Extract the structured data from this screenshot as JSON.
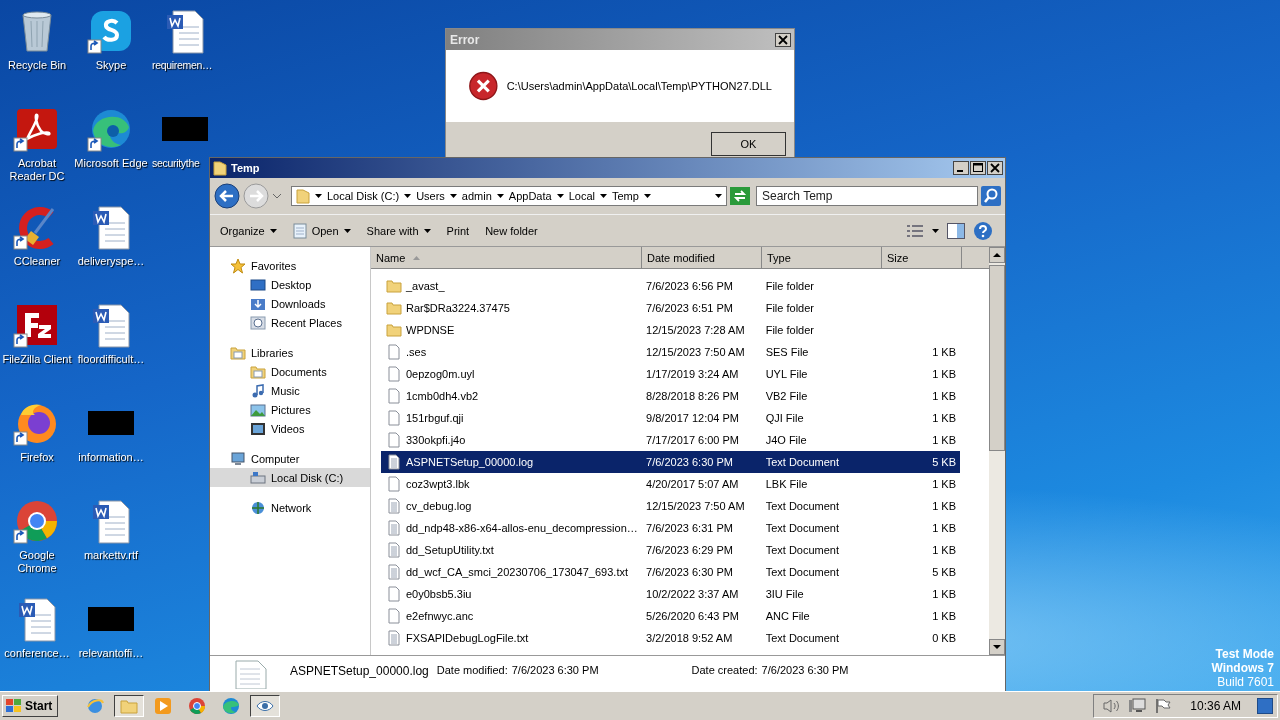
{
  "desktop": {
    "columns": [
      [
        {
          "label": "Recycle Bin",
          "kind": "recycle",
          "shortcut": false
        },
        {
          "label": "Acrobat Reader DC",
          "kind": "acrobat",
          "shortcut": true
        },
        {
          "label": "CCleaner",
          "kind": "ccleaner",
          "shortcut": true
        },
        {
          "label": "FileZilla Client",
          "kind": "filezilla",
          "shortcut": true
        },
        {
          "label": "Firefox",
          "kind": "firefox",
          "shortcut": true
        },
        {
          "label": "Google Chrome",
          "kind": "chrome",
          "shortcut": true
        },
        {
          "label": "conference…",
          "kind": "word",
          "shortcut": false
        }
      ],
      [
        {
          "label": "Skype",
          "kind": "skype",
          "shortcut": true
        },
        {
          "label": "Microsoft Edge",
          "kind": "edge",
          "shortcut": true
        },
        {
          "label": "deliveryspe…",
          "kind": "word",
          "shortcut": false
        },
        {
          "label": "floordifficult…",
          "kind": "word",
          "shortcut": false
        },
        {
          "label": "information…",
          "kind": "black",
          "shortcut": false
        },
        {
          "label": "markettv.rtf",
          "kind": "word",
          "shortcut": false
        },
        {
          "label": "relevantoffi…",
          "kind": "black",
          "shortcut": false
        }
      ],
      [
        {
          "label": "requiremen…",
          "kind": "word",
          "shortcut": false
        },
        {
          "label": "securitythe",
          "kind": "black",
          "shortcut": false
        }
      ]
    ],
    "os_notice": [
      "Test Mode",
      "Windows 7",
      "Build 7601"
    ]
  },
  "error_dialog": {
    "title": "Error",
    "message": "C:\\Users\\admin\\AppData\\Local\\Temp\\PYTHON27.DLL",
    "button": "OK"
  },
  "explorer": {
    "title": "Temp",
    "breadcrumb": [
      "Local Disk (C:)",
      "Users",
      "admin",
      "AppData",
      "Local",
      "Temp"
    ],
    "search": {
      "placeholder": "Search Temp"
    },
    "toolbar": [
      {
        "label": "Organize",
        "dropdown": true,
        "kind": "plain"
      },
      {
        "label": "Open",
        "dropdown": true,
        "kind": "open"
      },
      {
        "label": "Share with",
        "dropdown": true,
        "kind": "plain"
      },
      {
        "label": "Print",
        "dropdown": false,
        "kind": "plain"
      },
      {
        "label": "New folder",
        "dropdown": false,
        "kind": "plain"
      }
    ],
    "nav": [
      {
        "label": "Favorites",
        "kind": "star",
        "selected": false,
        "children": [
          {
            "label": "Desktop",
            "kind": "desktop",
            "selected": false
          },
          {
            "label": "Downloads",
            "kind": "downloads",
            "selected": false
          },
          {
            "label": "Recent Places",
            "kind": "recent",
            "selected": false
          }
        ]
      },
      {
        "label": "Libraries",
        "kind": "library",
        "selected": false,
        "children": [
          {
            "label": "Documents",
            "kind": "documents",
            "selected": false
          },
          {
            "label": "Music",
            "kind": "music",
            "selected": false
          },
          {
            "label": "Pictures",
            "kind": "pictures",
            "selected": false
          },
          {
            "label": "Videos",
            "kind": "videos",
            "selected": false
          }
        ]
      },
      {
        "label": "Computer",
        "kind": "computer",
        "selected": false,
        "children": [
          {
            "label": "Local Disk (C:)",
            "kind": "drive",
            "selected": true
          }
        ]
      },
      {
        "label": "Network",
        "kind": "network",
        "selected": false
      }
    ],
    "columns": [
      {
        "label": "Name",
        "sorted": true
      },
      {
        "label": "Date modified",
        "sorted": false
      },
      {
        "label": "Type",
        "sorted": false
      },
      {
        "label": "Size",
        "sorted": false
      }
    ],
    "files": [
      {
        "name": "_avast_",
        "date": "7/6/2023 6:56 PM",
        "type": "File folder",
        "kind": "folder",
        "selected": false
      },
      {
        "name": "Rar$DRa3224.37475",
        "date": "7/6/2023 6:51 PM",
        "type": "File folder",
        "kind": "folder",
        "selected": false
      },
      {
        "name": "WPDNSE",
        "date": "12/15/2023 7:28 AM",
        "type": "File folder",
        "kind": "folder",
        "selected": false
      },
      {
        "name": ".ses",
        "date": "12/15/2023 7:50 AM",
        "type": "SES File",
        "size": "1 KB",
        "kind": "file",
        "selected": false
      },
      {
        "name": "0epzog0m.uyl",
        "date": "1/17/2019 3:24 AM",
        "type": "UYL File",
        "size": "1 KB",
        "kind": "file",
        "selected": false
      },
      {
        "name": "1cmb0dh4.vb2",
        "date": "8/28/2018 8:26 PM",
        "type": "VB2 File",
        "size": "1 KB",
        "kind": "file",
        "selected": false
      },
      {
        "name": "151rbguf.qji",
        "date": "9/8/2017 12:04 PM",
        "type": "QJI File",
        "size": "1 KB",
        "kind": "file",
        "selected": false
      },
      {
        "name": "330okpfi.j4o",
        "date": "7/17/2017 6:00 PM",
        "type": "J4O File",
        "size": "1 KB",
        "kind": "file",
        "selected": false
      },
      {
        "name": "ASPNETSetup_00000.log",
        "date": "7/6/2023 6:30 PM",
        "type": "Text Document",
        "size": "5 KB",
        "kind": "text",
        "selected": true
      },
      {
        "name": "coz3wpt3.lbk",
        "date": "4/20/2017 5:07 AM",
        "type": "LBK File",
        "size": "1 KB",
        "kind": "file",
        "selected": false
      },
      {
        "name": "cv_debug.log",
        "date": "12/15/2023 7:50 AM",
        "type": "Text Document",
        "size": "1 KB",
        "kind": "text",
        "selected": false
      },
      {
        "name": "dd_ndp48-x86-x64-allos-enu_decompression…",
        "date": "7/6/2023 6:31 PM",
        "type": "Text Document",
        "size": "1 KB",
        "kind": "text",
        "selected": false
      },
      {
        "name": "dd_SetupUtility.txt",
        "date": "7/6/2023 6:29 PM",
        "type": "Text Document",
        "size": "1 KB",
        "kind": "text",
        "selected": false
      },
      {
        "name": "dd_wcf_CA_smci_20230706_173047_693.txt",
        "date": "7/6/2023 6:30 PM",
        "type": "Text Document",
        "size": "5 KB",
        "kind": "text",
        "selected": false
      },
      {
        "name": "e0y0bsb5.3iu",
        "date": "10/2/2022 3:37 AM",
        "type": "3IU File",
        "size": "1 KB",
        "kind": "file",
        "selected": false
      },
      {
        "name": "e2efnwyc.anc",
        "date": "5/26/2020 6:43 PM",
        "type": "ANC File",
        "size": "1 KB",
        "kind": "file",
        "selected": false
      },
      {
        "name": "FXSAPIDebugLogFile.txt",
        "date": "3/2/2018 9:52 AM",
        "type": "Text Document",
        "size": "0 KB",
        "kind": "text",
        "selected": false
      }
    ],
    "details": {
      "name": "ASPNETSetup_00000.log",
      "fields": [
        {
          "label": "Date modified:",
          "value": "7/6/2023 6:30 PM"
        },
        {
          "label": "Date created:",
          "value": "7/6/2023 6:30 PM"
        }
      ]
    }
  },
  "taskbar": {
    "start": "Start",
    "items": [
      {
        "kind": "ie",
        "pressed": false
      },
      {
        "kind": "explorer",
        "pressed": true
      },
      {
        "kind": "media",
        "pressed": false
      },
      {
        "kind": "chrome",
        "pressed": false
      },
      {
        "kind": "edge",
        "pressed": false
      },
      {
        "kind": "eye",
        "pressed": true
      }
    ],
    "clock": "10:36 AM"
  }
}
